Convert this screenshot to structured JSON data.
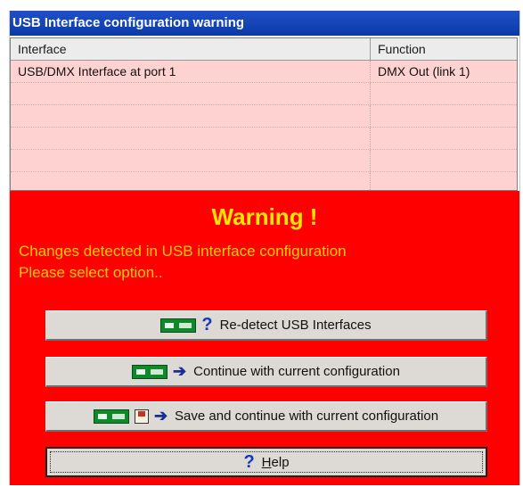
{
  "window": {
    "title": "USB Interface configuration warning"
  },
  "table": {
    "headers": {
      "interface": "Interface",
      "function": "Function"
    },
    "rows": [
      {
        "interface": "USB/DMX Interface at port 1",
        "function": "DMX Out (link 1)"
      },
      {
        "interface": "",
        "function": ""
      },
      {
        "interface": "",
        "function": ""
      },
      {
        "interface": "",
        "function": ""
      },
      {
        "interface": "",
        "function": ""
      },
      {
        "interface": "",
        "function": ""
      }
    ]
  },
  "warning": {
    "title": "Warning !",
    "line1": "Changes detected in USB interface configuration",
    "line2": "Please select option.."
  },
  "buttons": {
    "redetect": "Re-detect USB Interfaces",
    "continue": "Continue with current configuration",
    "save_continue": "Save and continue with current configuration",
    "help_first": "H",
    "help_rest": "elp"
  },
  "icons": {
    "interface_chip": "usb-interface-chip-icon",
    "question": "question-mark-icon",
    "arrow": "right-arrow-icon",
    "save": "save-disk-icon"
  },
  "colors": {
    "panel": "#ff0000",
    "warning_title": "#ffe600",
    "warning_text": "#ffcc00",
    "table_bg": "#ffd2d2"
  }
}
